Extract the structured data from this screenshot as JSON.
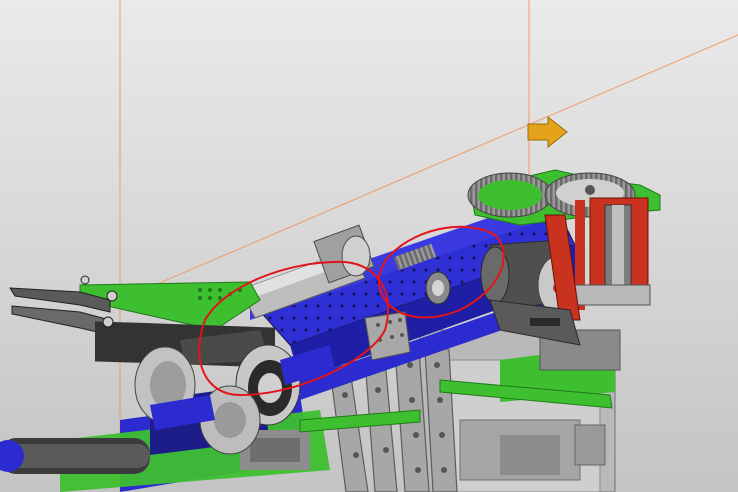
{
  "viewport": {
    "background_top": "#e9e9e9",
    "background_bottom": "#c6c6c6"
  },
  "colors": {
    "green": "#3dbf2f",
    "dark_green": "#1f7a18",
    "blue": "#2b2bd0",
    "dark_blue": "#1d1d8a",
    "gray": "#b9b9b9",
    "dark_gray": "#6e6e6e",
    "red_section": "#c8321e",
    "annotation_red": "#e3141a",
    "guide_line": "#f29a6a",
    "handle": "#e3a21a"
  },
  "icons": {
    "move_handle": "arrow-right-handle"
  },
  "annotations": {
    "count": 2,
    "style": "freehand red ellipses"
  }
}
